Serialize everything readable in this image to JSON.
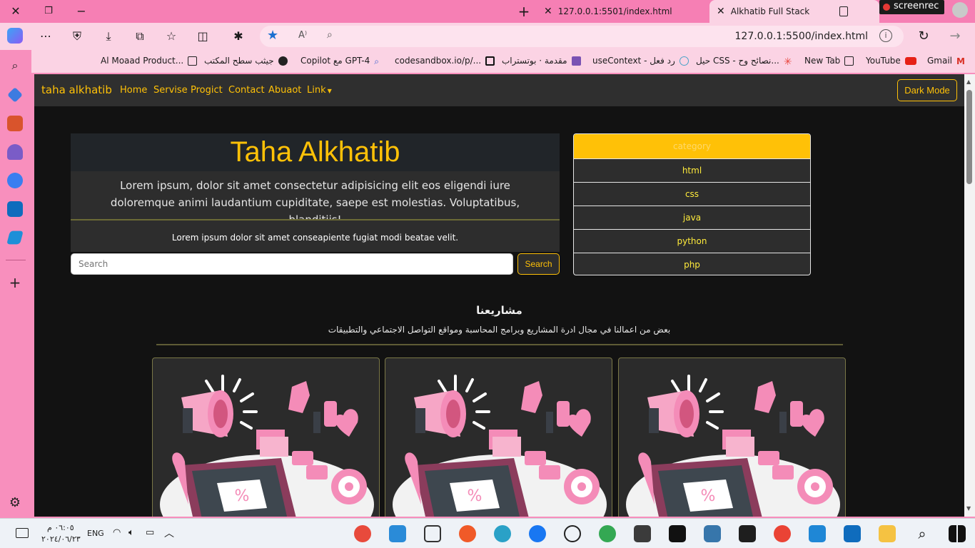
{
  "browser": {
    "tabs": [
      {
        "title": "127.0.0.1:5501/index.html",
        "active": false
      },
      {
        "title": "Alkhatib Full Stack",
        "active": true
      }
    ],
    "screenrec_label": "screenrec",
    "url": "127.0.0.1:5500/index.html",
    "favorites": [
      "Al Moaad Product...",
      "جيثب سطح المكتب",
      "Copilot مع GPT-4",
      "codesandbox.io/p/...",
      "مقدمة · بوتستراب",
      "useContext - رد فعل",
      "حيل CSS - نصائح وح...",
      "New Tab",
      "YouTube",
      "Gmail"
    ]
  },
  "site": {
    "brand": "taha alkhatib",
    "nav": [
      "Home",
      "Servise",
      "Progict",
      "Contact",
      "Abuaot",
      "Link"
    ],
    "dark_mode_label": "Dark Mode",
    "hero": {
      "title": "Taha Alkhatib",
      "lead": "Lorem ipsum, dolor sit amet consectetur adipisicing elit eos eligendi iure doloremque animi laudantium cupiditate, saepe est molestias. Voluptatibus, blanditiis!",
      "sub": "Lorem ipsum dolor sit amet conseapiente fugiat modi beatae velit."
    },
    "search": {
      "placeholder": "Search",
      "button": "Search"
    },
    "category": {
      "header": "category",
      "items": [
        "html",
        "css",
        "java",
        "python",
        "php"
      ]
    },
    "projects": {
      "title": "مشاريعنا",
      "subtitle": "بعض من اعمالنا في مجال ادرة المشاريع وبرامج المحاسبة ومواقع التواصل الاجتماعي والتطبيقات",
      "card_count": 3
    }
  },
  "taskbar": {
    "time": "٠٦:٠٥ م",
    "date": "٢٠٢٤/٠٦/٢٣",
    "lang": "ENG"
  },
  "colors": {
    "accent": "#ffc107",
    "page_bg": "#121212",
    "panel_bg": "#2d2d2d",
    "chrome_pink": "#f88fbd"
  }
}
